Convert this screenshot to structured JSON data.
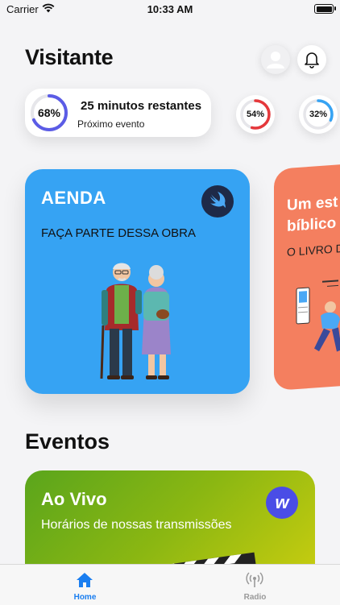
{
  "status_bar": {
    "carrier": "Carrier",
    "time": "10:33 AM"
  },
  "header": {
    "title": "Visitante",
    "icons": [
      "person-icon",
      "bell-icon"
    ]
  },
  "progress": {
    "main": {
      "percent_label": "68%",
      "percent": 68,
      "title": "25 minutos restantes",
      "subtitle": "Próximo evento",
      "color": "#5b5ce6"
    },
    "minis": [
      {
        "percent_label": "54%",
        "percent": 54,
        "color": "#e5383b"
      },
      {
        "percent_label": "32%",
        "percent": 32,
        "color": "#36a3f3"
      }
    ]
  },
  "featured": [
    {
      "title": "AENDA",
      "subtitle": "FAÇA PARTE DESSA OBRA",
      "color": "#36a3f3",
      "icon": "swift-icon"
    },
    {
      "title_line1": "Um est",
      "title_line2": "bíblico",
      "subtitle": "O LIVRO D",
      "color": "#f47f5f"
    }
  ],
  "events": {
    "section_title": "Eventos",
    "cards": [
      {
        "title": "Ao Vivo",
        "subtitle": "Horários de nossas transmissões",
        "icon": "webflow-icon",
        "logo_letter": "w"
      }
    ]
  },
  "tab_bar": {
    "items": [
      {
        "label": "Home",
        "icon": "house-icon",
        "active": true
      },
      {
        "label": "Radio",
        "icon": "antenna-icon",
        "active": false
      }
    ],
    "active_color": "#1a7ef0"
  }
}
